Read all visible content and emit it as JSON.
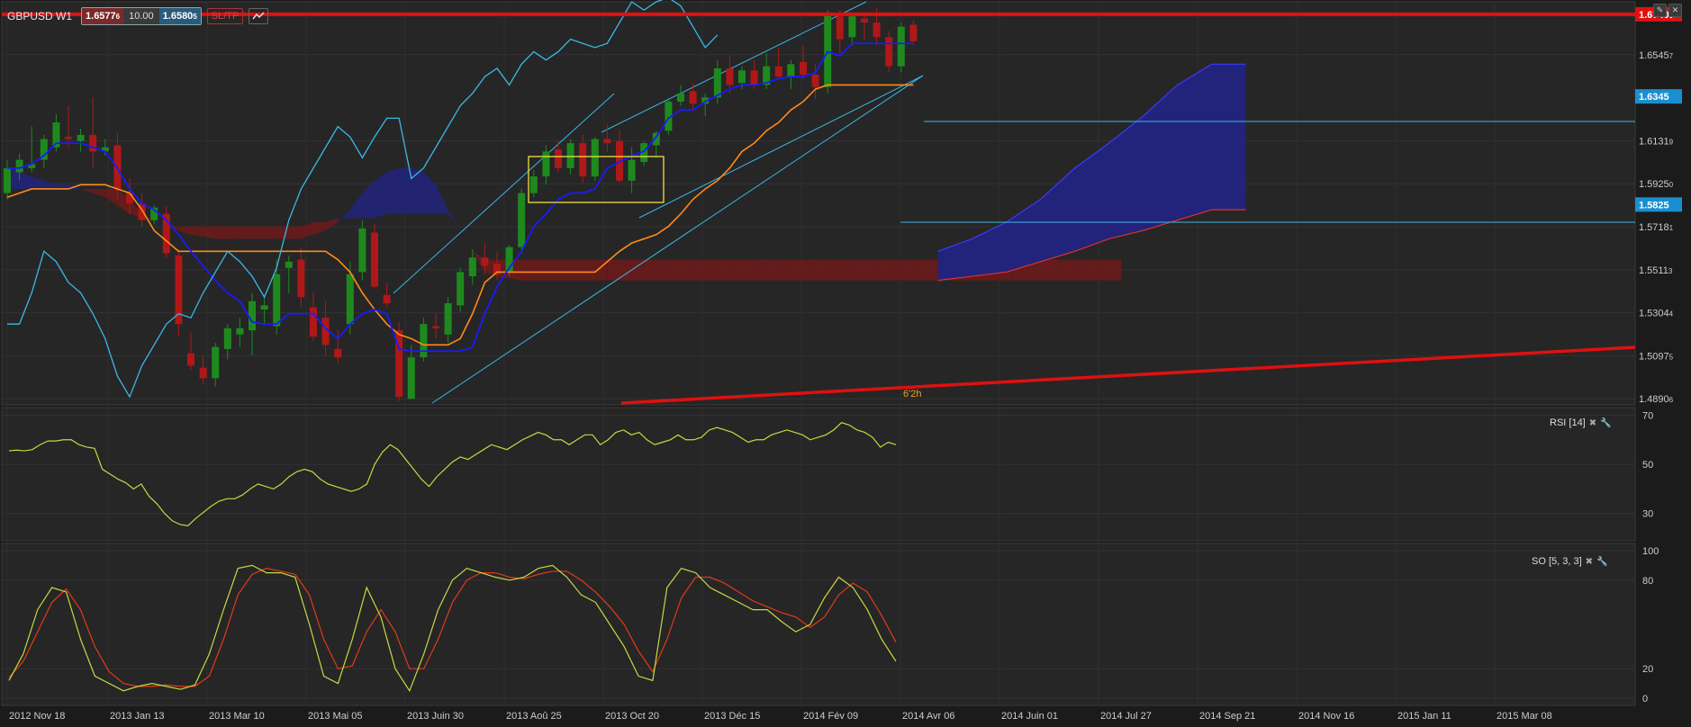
{
  "toolbar": {
    "symbol": "GBPUSD W1",
    "bid": "1.6577",
    "bid_small": "6",
    "quantity": "10.00",
    "ask": "1.6580",
    "ask_small": "5",
    "sltp_label": "SL/TP",
    "line_tool_icon": "line-chart-icon"
  },
  "window_buttons": [
    "pencil-icon",
    "close-icon"
  ],
  "price_axis": {
    "labels": [
      {
        "text": "1.6545",
        "small": "7",
        "value": 1.65457
      },
      {
        "text": "1.6131",
        "small": "9",
        "value": 1.61319
      },
      {
        "text": "1.5925",
        "small": "0",
        "value": 1.5925
      },
      {
        "text": "1.5718",
        "small": "1",
        "value": 1.57181
      },
      {
        "text": "1.5511",
        "small": "3",
        "value": 1.55113
      },
      {
        "text": "1.5304",
        "small": "4",
        "value": 1.53044
      },
      {
        "text": "1.5097",
        "small": "5",
        "value": 1.50975
      },
      {
        "text": "1.4890",
        "small": "6",
        "value": 1.48906
      }
    ],
    "tags": [
      {
        "text": "1.6740",
        "small": "0",
        "value": 1.674,
        "color": "#e01010"
      },
      {
        "text": "1.6345",
        "small": "",
        "value": 1.6345,
        "color": "#1a8fd0"
      },
      {
        "text": "1.5825",
        "small": "",
        "value": 1.5825,
        "color": "#1a8fd0"
      }
    ]
  },
  "date_axis": [
    "2012 Nov 18",
    "2013 Jan 13",
    "2013 Mar 10",
    "2013 Mai 05",
    "2013 Juin 30",
    "2013 Aoû 25",
    "2013 Oct 20",
    "2013 Déc 15",
    "2014 Fév 09",
    "2014 Avr 06",
    "2014 Juin 01",
    "2014 Jul 27",
    "2014 Sep 21",
    "2014 Nov 16",
    "2015 Jan 11",
    "2015 Mar 08"
  ],
  "annotation": "6'2h",
  "rsi": {
    "label": "RSI [14]",
    "levels": [
      "70",
      "50",
      "30"
    ],
    "line_color": "#c8d840"
  },
  "so": {
    "label": "SO [5, 3, 3]",
    "levels": [
      "100",
      "80",
      "20",
      "0"
    ],
    "k_color": "#c8d840",
    "d_color": "#e03a1a"
  },
  "colors": {
    "background": "#1b1b1b",
    "bull_candle": "#1e8a1e",
    "bear_candle": "#b01818",
    "tenkan": "#1a1aff",
    "kijun": "#ff8a1a",
    "chikou": "#3ab8e8",
    "cloud_bull": "#22237a",
    "cloud_bear": "#6a1b1b",
    "resistance_line": "#e01010",
    "channel": "#3ab8e8"
  },
  "chart_data": {
    "type": "candlestick",
    "title": "GBPUSD W1",
    "timeframe": "W1",
    "ylim": [
      1.489,
      1.68
    ],
    "x_tick_labels": [
      "2012 Nov 18",
      "2013 Jan 13",
      "2013 Mar 10",
      "2013 Mai 05",
      "2013 Juin 30",
      "2013 Aoû 25",
      "2013 Oct 20",
      "2013 Déc 15",
      "2014 Fév 09",
      "2014 Avr 06",
      "2014 Juin 01",
      "2014 Jul 27",
      "2014 Sep 21",
      "2014 Nov 16",
      "2015 Jan 11",
      "2015 Mar 08"
    ],
    "candles": [
      {
        "o": 1.588,
        "h": 1.604,
        "l": 1.585,
        "c": 1.6
      },
      {
        "o": 1.598,
        "h": 1.607,
        "l": 1.594,
        "c": 1.604
      },
      {
        "o": 1.6,
        "h": 1.62,
        "l": 1.598,
        "c": 1.602
      },
      {
        "o": 1.604,
        "h": 1.616,
        "l": 1.6,
        "c": 1.614
      },
      {
        "o": 1.61,
        "h": 1.626,
        "l": 1.608,
        "c": 1.622
      },
      {
        "o": 1.615,
        "h": 1.63,
        "l": 1.61,
        "c": 1.614
      },
      {
        "o": 1.613,
        "h": 1.619,
        "l": 1.608,
        "c": 1.616
      },
      {
        "o": 1.616,
        "h": 1.634,
        "l": 1.6,
        "c": 1.608
      },
      {
        "o": 1.608,
        "h": 1.614,
        "l": 1.606,
        "c": 1.61
      },
      {
        "o": 1.611,
        "h": 1.617,
        "l": 1.585,
        "c": 1.59
      },
      {
        "o": 1.588,
        "h": 1.595,
        "l": 1.578,
        "c": 1.583
      },
      {
        "o": 1.583,
        "h": 1.588,
        "l": 1.572,
        "c": 1.575
      },
      {
        "o": 1.575,
        "h": 1.582,
        "l": 1.573,
        "c": 1.581
      },
      {
        "o": 1.578,
        "h": 1.582,
        "l": 1.557,
        "c": 1.559
      },
      {
        "o": 1.558,
        "h": 1.561,
        "l": 1.519,
        "c": 1.525
      },
      {
        "o": 1.511,
        "h": 1.521,
        "l": 1.503,
        "c": 1.505
      },
      {
        "o": 1.504,
        "h": 1.51,
        "l": 1.496,
        "c": 1.499
      },
      {
        "o": 1.499,
        "h": 1.516,
        "l": 1.495,
        "c": 1.514
      },
      {
        "o": 1.513,
        "h": 1.525,
        "l": 1.508,
        "c": 1.523
      },
      {
        "o": 1.52,
        "h": 1.528,
        "l": 1.514,
        "c": 1.523
      },
      {
        "o": 1.522,
        "h": 1.54,
        "l": 1.51,
        "c": 1.536
      },
      {
        "o": 1.532,
        "h": 1.538,
        "l": 1.525,
        "c": 1.534
      },
      {
        "o": 1.524,
        "h": 1.556,
        "l": 1.52,
        "c": 1.549
      },
      {
        "o": 1.552,
        "h": 1.558,
        "l": 1.54,
        "c": 1.555
      },
      {
        "o": 1.556,
        "h": 1.562,
        "l": 1.533,
        "c": 1.538
      },
      {
        "o": 1.533,
        "h": 1.54,
        "l": 1.517,
        "c": 1.519
      },
      {
        "o": 1.528,
        "h": 1.536,
        "l": 1.51,
        "c": 1.515
      },
      {
        "o": 1.513,
        "h": 1.522,
        "l": 1.506,
        "c": 1.509
      },
      {
        "o": 1.525,
        "h": 1.555,
        "l": 1.52,
        "c": 1.549
      },
      {
        "o": 1.55,
        "h": 1.575,
        "l": 1.546,
        "c": 1.571
      },
      {
        "o": 1.569,
        "h": 1.573,
        "l": 1.542,
        "c": 1.543
      },
      {
        "o": 1.539,
        "h": 1.545,
        "l": 1.533,
        "c": 1.535
      },
      {
        "o": 1.522,
        "h": 1.526,
        "l": 1.488,
        "c": 1.49
      },
      {
        "o": 1.489,
        "h": 1.515,
        "l": 1.489,
        "c": 1.509
      },
      {
        "o": 1.509,
        "h": 1.528,
        "l": 1.507,
        "c": 1.525
      },
      {
        "o": 1.524,
        "h": 1.53,
        "l": 1.518,
        "c": 1.523
      },
      {
        "o": 1.52,
        "h": 1.538,
        "l": 1.516,
        "c": 1.535
      },
      {
        "o": 1.534,
        "h": 1.552,
        "l": 1.531,
        "c": 1.55
      },
      {
        "o": 1.548,
        "h": 1.561,
        "l": 1.544,
        "c": 1.557
      },
      {
        "o": 1.557,
        "h": 1.564,
        "l": 1.549,
        "c": 1.553
      },
      {
        "o": 1.554,
        "h": 1.56,
        "l": 1.546,
        "c": 1.549
      },
      {
        "o": 1.55,
        "h": 1.563,
        "l": 1.548,
        "c": 1.562
      },
      {
        "o": 1.562,
        "h": 1.59,
        "l": 1.559,
        "c": 1.588
      },
      {
        "o": 1.588,
        "h": 1.599,
        "l": 1.586,
        "c": 1.596
      },
      {
        "o": 1.596,
        "h": 1.611,
        "l": 1.592,
        "c": 1.608
      },
      {
        "o": 1.609,
        "h": 1.613,
        "l": 1.598,
        "c": 1.6
      },
      {
        "o": 1.6,
        "h": 1.614,
        "l": 1.597,
        "c": 1.612
      },
      {
        "o": 1.612,
        "h": 1.616,
        "l": 1.593,
        "c": 1.596
      },
      {
        "o": 1.596,
        "h": 1.615,
        "l": 1.594,
        "c": 1.614
      },
      {
        "o": 1.614,
        "h": 1.621,
        "l": 1.608,
        "c": 1.612
      },
      {
        "o": 1.613,
        "h": 1.618,
        "l": 1.593,
        "c": 1.594
      },
      {
        "o": 1.594,
        "h": 1.61,
        "l": 1.588,
        "c": 1.604
      },
      {
        "o": 1.603,
        "h": 1.613,
        "l": 1.601,
        "c": 1.612
      },
      {
        "o": 1.611,
        "h": 1.618,
        "l": 1.605,
        "c": 1.617
      },
      {
        "o": 1.618,
        "h": 1.633,
        "l": 1.616,
        "c": 1.632
      },
      {
        "o": 1.632,
        "h": 1.64,
        "l": 1.63,
        "c": 1.636
      },
      {
        "o": 1.637,
        "h": 1.641,
        "l": 1.628,
        "c": 1.631
      },
      {
        "o": 1.631,
        "h": 1.636,
        "l": 1.625,
        "c": 1.634
      },
      {
        "o": 1.634,
        "h": 1.652,
        "l": 1.631,
        "c": 1.648
      },
      {
        "o": 1.648,
        "h": 1.654,
        "l": 1.636,
        "c": 1.64
      },
      {
        "o": 1.641,
        "h": 1.649,
        "l": 1.638,
        "c": 1.647
      },
      {
        "o": 1.647,
        "h": 1.652,
        "l": 1.638,
        "c": 1.64
      },
      {
        "o": 1.64,
        "h": 1.655,
        "l": 1.638,
        "c": 1.649
      },
      {
        "o": 1.649,
        "h": 1.658,
        "l": 1.643,
        "c": 1.644
      },
      {
        "o": 1.644,
        "h": 1.652,
        "l": 1.638,
        "c": 1.65
      },
      {
        "o": 1.651,
        "h": 1.659,
        "l": 1.643,
        "c": 1.645
      },
      {
        "o": 1.645,
        "h": 1.65,
        "l": 1.633,
        "c": 1.639
      },
      {
        "o": 1.639,
        "h": 1.676,
        "l": 1.636,
        "c": 1.674
      },
      {
        "o": 1.673,
        "h": 1.676,
        "l": 1.655,
        "c": 1.662
      },
      {
        "o": 1.663,
        "h": 1.675,
        "l": 1.659,
        "c": 1.673
      },
      {
        "o": 1.672,
        "h": 1.675,
        "l": 1.662,
        "c": 1.67
      },
      {
        "o": 1.67,
        "h": 1.677,
        "l": 1.659,
        "c": 1.663
      },
      {
        "o": 1.663,
        "h": 1.666,
        "l": 1.646,
        "c": 1.649
      },
      {
        "o": 1.649,
        "h": 1.67,
        "l": 1.646,
        "c": 1.668
      },
      {
        "o": 1.669,
        "h": 1.671,
        "l": 1.659,
        "c": 1.661
      }
    ],
    "tenkan": [
      1.6,
      1.6,
      1.602,
      1.606,
      1.612,
      1.612,
      1.612,
      1.61,
      1.608,
      1.6,
      1.59,
      1.583,
      1.58,
      1.575,
      1.568,
      1.56,
      1.553,
      1.546,
      1.54,
      1.536,
      1.526,
      1.525,
      1.525,
      1.53,
      1.53,
      1.53,
      1.523,
      1.518,
      1.525,
      1.53,
      1.532,
      1.53,
      1.513,
      1.512,
      1.512,
      1.512,
      1.512,
      1.512,
      1.514,
      1.53,
      1.543,
      1.552,
      1.56,
      1.572,
      1.578,
      1.585,
      1.588,
      1.588,
      1.59,
      1.6,
      1.603,
      1.606,
      1.608,
      1.615,
      1.624,
      1.628,
      1.628,
      1.632,
      1.635,
      1.638,
      1.64,
      1.64,
      1.641,
      1.643,
      1.644,
      1.644,
      1.646,
      1.656,
      1.654,
      1.66,
      1.66,
      1.66,
      1.66,
      1.66,
      1.66
    ],
    "kijun": [
      1.586,
      1.588,
      1.59,
      1.59,
      1.59,
      1.59,
      1.592,
      1.592,
      1.592,
      1.59,
      1.588,
      1.58,
      1.57,
      1.565,
      1.56,
      1.56,
      1.56,
      1.56,
      1.56,
      1.56,
      1.56,
      1.56,
      1.56,
      1.56,
      1.56,
      1.56,
      1.56,
      1.556,
      1.55,
      1.54,
      1.532,
      1.525,
      1.52,
      1.518,
      1.515,
      1.515,
      1.515,
      1.518,
      1.53,
      1.545,
      1.55,
      1.55,
      1.55,
      1.55,
      1.55,
      1.55,
      1.55,
      1.55,
      1.55,
      1.555,
      1.56,
      1.564,
      1.566,
      1.568,
      1.572,
      1.578,
      1.585,
      1.59,
      1.594,
      1.6,
      1.608,
      1.612,
      1.618,
      1.622,
      1.628,
      1.632,
      1.638,
      1.64,
      1.64,
      1.64,
      1.64,
      1.64,
      1.64,
      1.64,
      1.64
    ],
    "cloud": {
      "span_a": [
        1.6,
        1.598,
        1.596,
        1.594,
        1.592,
        1.592,
        1.59,
        1.588,
        1.586,
        1.582,
        1.578,
        1.576,
        1.575,
        1.572,
        1.57,
        1.568,
        1.567,
        1.566,
        1.566,
        1.566,
        1.566,
        1.566,
        1.566,
        1.566,
        1.566,
        1.568,
        1.57,
        1.574,
        1.58,
        1.588,
        1.594,
        1.598,
        1.6,
        1.6,
        1.598,
        1.592,
        1.58,
        1.57,
        1.56,
        1.55,
        1.548,
        1.547,
        1.546,
        1.546,
        1.546,
        1.546,
        1.546,
        1.546,
        1.546,
        1.546,
        1.546,
        1.546,
        1.546,
        1.546,
        1.546,
        1.546,
        1.546,
        1.546,
        1.546,
        1.546,
        1.546,
        1.546,
        1.546,
        1.546,
        1.546,
        1.546,
        1.546,
        1.546,
        1.546,
        1.546,
        1.546,
        1.546,
        1.546,
        1.546,
        1.546,
        1.546,
        1.546,
        1.546,
        1.546,
        1.546,
        1.546,
        1.546,
        1.546,
        1.546,
        1.546,
        1.546,
        1.546,
        1.546,
        1.546,
        1.546,
        1.546,
        1.546
      ],
      "span_b": [
        1.59,
        1.59,
        1.59,
        1.59,
        1.59,
        1.59,
        1.59,
        1.59,
        1.59,
        1.59,
        1.585,
        1.578,
        1.574,
        1.572,
        1.572,
        1.572,
        1.572,
        1.572,
        1.572,
        1.572,
        1.572,
        1.572,
        1.572,
        1.572,
        1.572,
        1.574,
        1.574,
        1.576,
        1.576,
        1.576,
        1.576,
        1.578,
        1.578,
        1.578,
        1.578,
        1.578,
        1.578,
        1.57,
        1.56,
        1.556,
        1.556,
        1.556,
        1.556,
        1.556,
        1.556,
        1.556,
        1.556,
        1.556,
        1.556,
        1.556,
        1.556,
        1.556,
        1.556,
        1.556,
        1.556,
        1.556,
        1.556,
        1.556,
        1.556,
        1.556,
        1.556,
        1.556,
        1.556,
        1.556,
        1.556,
        1.556,
        1.556,
        1.556,
        1.556,
        1.556,
        1.556,
        1.556,
        1.556,
        1.556,
        1.556,
        1.556,
        1.556,
        1.556,
        1.556,
        1.556,
        1.556,
        1.556,
        1.556,
        1.556,
        1.556,
        1.556,
        1.556,
        1.556,
        1.556,
        1.556,
        1.556,
        1.556
      ]
    },
    "chikou": [
      1.525,
      1.525,
      1.54,
      1.56,
      1.555,
      1.545,
      1.54,
      1.53,
      1.518,
      1.5,
      1.49,
      1.505,
      1.515,
      1.525,
      1.53,
      1.528,
      1.54,
      1.55,
      1.56,
      1.555,
      1.548,
      1.538,
      1.552,
      1.575,
      1.59,
      1.6,
      1.61,
      1.62,
      1.615,
      1.605,
      1.615,
      1.624,
      1.624,
      1.595,
      1.6,
      1.61,
      1.62,
      1.63,
      1.636,
      1.644,
      1.648,
      1.64,
      1.65,
      1.656,
      1.652,
      1.656,
      1.662,
      1.66,
      1.658,
      1.66,
      1.67,
      1.68,
      1.676,
      1.68,
      1.682,
      1.678,
      1.668,
      1.658,
      1.664
    ],
    "rsi": [
      55.5,
      55.8,
      55.5,
      56,
      58,
      59.5,
      59.5,
      60,
      60,
      58,
      57,
      56.5,
      48,
      46,
      44,
      42.5,
      40,
      42,
      37,
      34,
      30,
      27,
      25.5,
      25,
      28,
      30.5,
      33,
      35,
      36,
      36,
      37.5,
      40,
      42,
      41,
      40,
      42,
      45,
      47,
      48,
      47,
      44,
      42,
      41,
      40,
      39,
      40,
      42,
      50,
      55,
      58,
      56,
      52,
      48,
      44,
      41,
      45,
      48,
      51,
      53,
      52,
      54,
      56,
      58,
      57,
      56,
      58,
      60,
      61.5,
      63,
      62,
      60,
      60,
      58,
      60,
      62,
      62,
      58,
      60,
      63,
      64,
      62,
      63,
      60,
      58,
      59,
      60,
      62,
      60,
      60,
      61,
      64,
      65,
      64,
      63,
      61,
      59,
      60,
      60,
      62,
      63,
      64,
      63,
      62,
      60,
      61,
      62,
      64,
      67,
      66,
      64,
      63,
      61,
      57,
      59,
      58
    ],
    "so_k": [
      12,
      30,
      60,
      75,
      72,
      40,
      15,
      10,
      5,
      8,
      10,
      8,
      6,
      9,
      30,
      60,
      88,
      90,
      85,
      85,
      82,
      50,
      15,
      10,
      40,
      75,
      55,
      20,
      5,
      30,
      60,
      80,
      88,
      85,
      82,
      80,
      82,
      88,
      90,
      82,
      70,
      65,
      50,
      35,
      15,
      12,
      75,
      88,
      85,
      75,
      70,
      65,
      60,
      60,
      52,
      45,
      50,
      68,
      82,
      75,
      60,
      40,
      25
    ],
    "so_d": [
      14,
      25,
      45,
      65,
      74,
      60,
      35,
      18,
      10,
      8,
      8,
      9,
      8,
      8,
      15,
      40,
      70,
      84,
      88,
      86,
      84,
      70,
      40,
      20,
      22,
      45,
      60,
      45,
      20,
      20,
      40,
      65,
      80,
      85,
      85,
      82,
      81,
      84,
      86,
      86,
      80,
      72,
      62,
      50,
      32,
      18,
      40,
      68,
      82,
      82,
      78,
      72,
      66,
      62,
      58,
      55,
      48,
      55,
      70,
      78,
      72,
      56,
      38
    ]
  }
}
